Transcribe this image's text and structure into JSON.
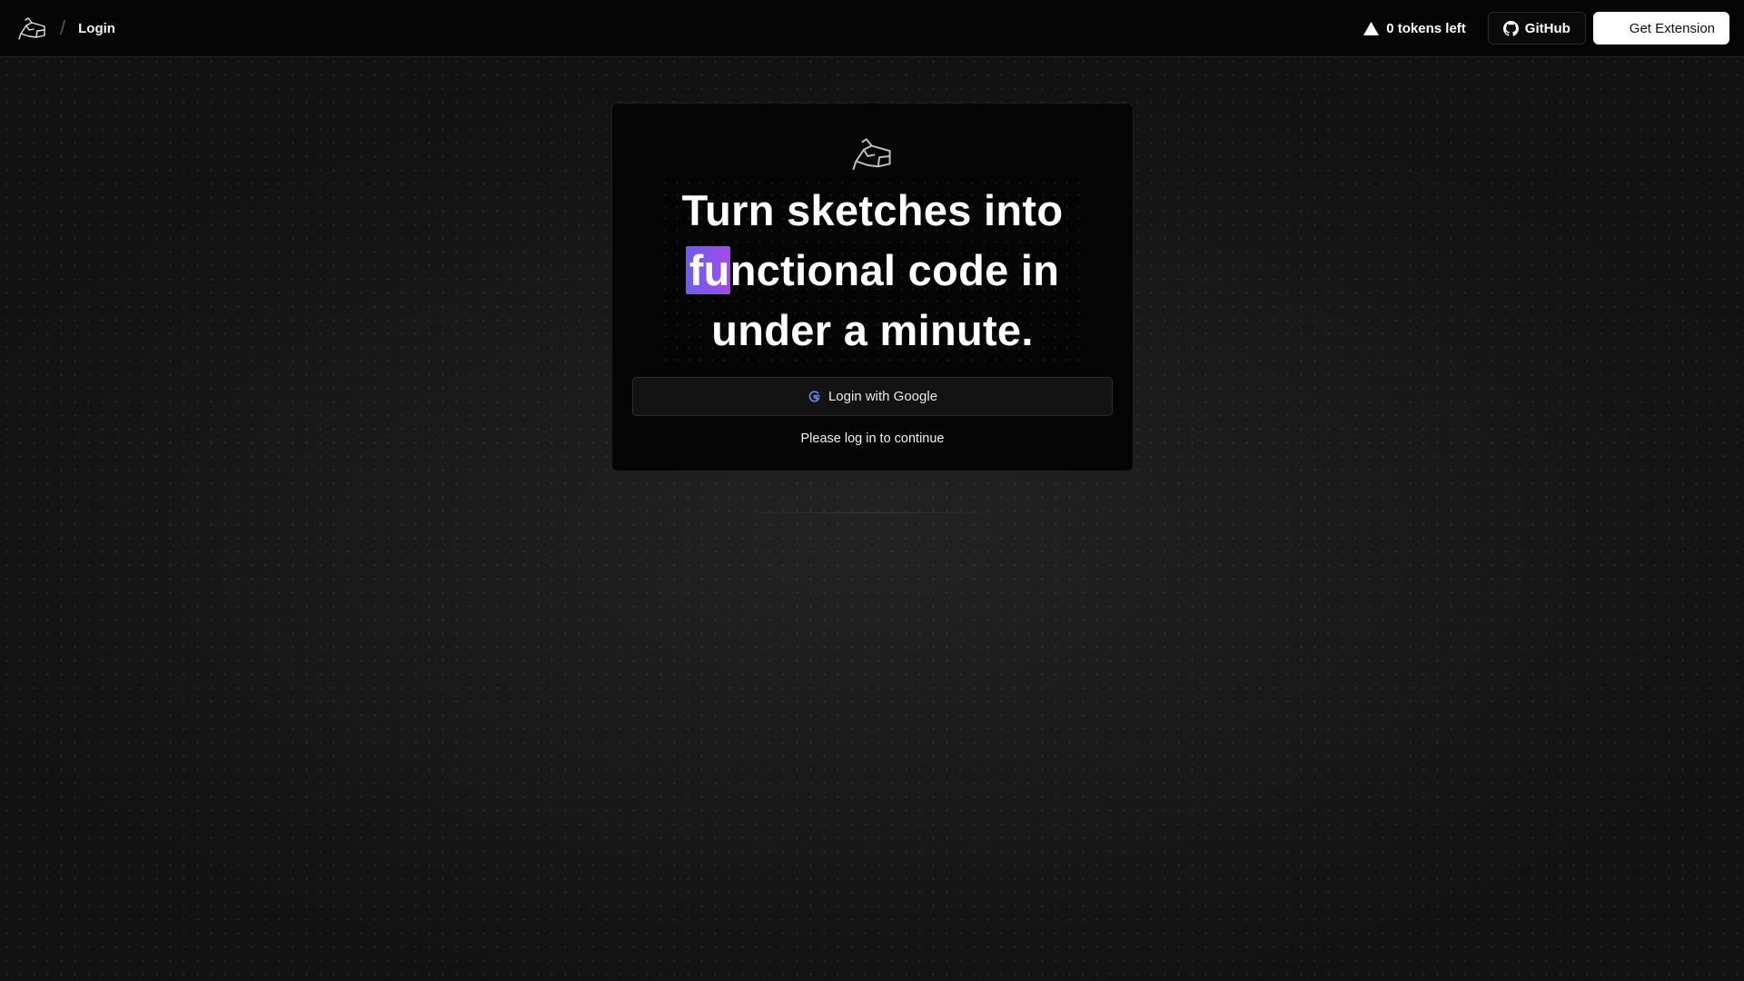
{
  "header": {
    "logo_icon": "hand-sketch-logo-icon",
    "breadcrumb": "Login",
    "tokens_label": "0 tokens left",
    "tokens_icon": "triangle-warning-icon",
    "github_label": "GitHub",
    "github_icon": "github-icon",
    "extension_label": "Get Extension"
  },
  "card": {
    "logo_icon": "hand-sketch-logo-icon",
    "headline": {
      "line1": "Turn sketches into",
      "highlight": "fu",
      "line2_rest": "nctional code in",
      "line3": "under a minute."
    },
    "login_button": "Login with Google",
    "google_icon": "google-icon",
    "hint": "Please log in to continue"
  },
  "colors": {
    "background": "#121212",
    "topbar": "#050505",
    "highlight_start": "#6a5cf3",
    "highlight_end": "#a24ce6",
    "primary_button": "#ffffff"
  }
}
